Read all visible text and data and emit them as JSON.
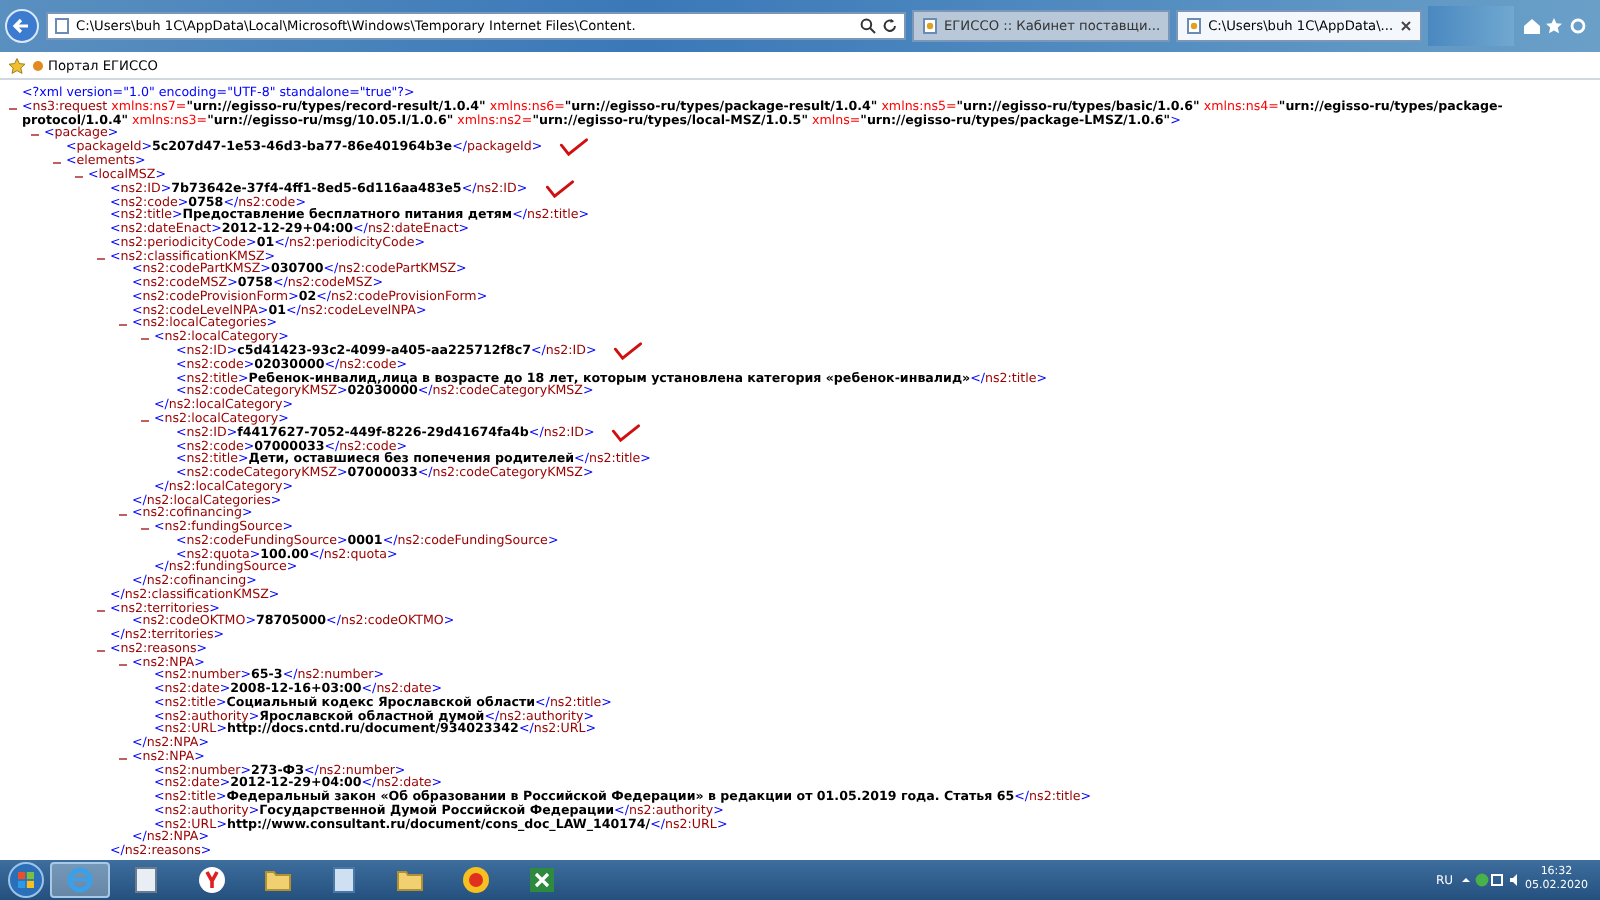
{
  "browser": {
    "address": "C:\\Users\\buh 1C\\AppData\\Local\\Microsoft\\Windows\\Temporary Internet Files\\Content.",
    "tabs": [
      {
        "title": "ЕГИССО :: Кабинет поставщи...",
        "selected": false
      },
      {
        "title": "C:\\Users\\buh 1C\\AppData\\...",
        "selected": true
      }
    ],
    "favorites": [
      {
        "label": "Портал ЕГИССО"
      }
    ]
  },
  "document": {
    "declaration": "<?xml version=\"1.0\" encoding=\"UTF-8\" standalone=\"true\"?>",
    "root": {
      "open": "<ns3:request",
      "attributes": [
        {
          "name": "xmlns:ns7=",
          "value": "\"urn://egisso-ru/types/record-result/1.0.4\""
        },
        {
          "name": "xmlns:ns6=",
          "value": "\"urn://egisso-ru/types/package-result/1.0.4\""
        },
        {
          "name": "xmlns:ns5=",
          "value": "\"urn://egisso-ru/types/basic/1.0.6\""
        },
        {
          "name": "xmlns:ns4=",
          "value": "\"urn://egisso-ru/types/package-protocol/1.0.4\""
        },
        {
          "name": "xmlns:ns3=",
          "value": "\"urn://egisso-ru/msg/10.05.I/1.0.6\""
        },
        {
          "name": "xmlns:ns2=",
          "value": "\"urn://egisso-ru/types/local-MSZ/1.0.5\""
        },
        {
          "name": "xmlns=",
          "value": "\"urn://egisso-ru/types/package-LMSZ/1.0.6\""
        }
      ],
      "open_end": ">",
      "expanded": true,
      "children": [
        {
          "open": "<package>",
          "expanded": true,
          "children": [
            {
              "open": "<packageId>",
              "value": "5c207d47-1e53-46d3-ba77-86e401964b3e",
              "close": "</packageId>",
              "annotated": true
            },
            {
              "open": "<elements>",
              "expanded": true,
              "children": [
                {
                  "open": "<localMSZ>",
                  "expanded": true,
                  "children": [
                    {
                      "open": "<ns2:ID>",
                      "value": "7b73642e-37f4-4ff1-8ed5-6d116aa483e5",
                      "close": "</ns2:ID>",
                      "annotated": true
                    },
                    {
                      "open": "<ns2:code>",
                      "value": "0758",
                      "close": "</ns2:code>",
                      "annotated": false
                    },
                    {
                      "open": "<ns2:title>",
                      "value": "Предоставление бесплатного питания детям",
                      "close": "</ns2:title>",
                      "annotated": false
                    },
                    {
                      "open": "<ns2:dateEnact>",
                      "value": "2012-12-29+04:00",
                      "close": "</ns2:dateEnact>",
                      "annotated": false
                    },
                    {
                      "open": "<ns2:periodicityCode>",
                      "value": "01",
                      "close": "</ns2:periodicityCode>",
                      "annotated": false
                    },
                    {
                      "open": "<ns2:classificationKMSZ>",
                      "expanded": true,
                      "close": "</ns2:classificationKMSZ>",
                      "children": [
                        {
                          "open": "<ns2:codePartKMSZ>",
                          "value": "030700",
                          "close": "</ns2:codePartKMSZ>",
                          "annotated": false
                        },
                        {
                          "open": "<ns2:codeMSZ>",
                          "value": "0758",
                          "close": "</ns2:codeMSZ>",
                          "annotated": false
                        },
                        {
                          "open": "<ns2:codeProvisionForm>",
                          "value": "02",
                          "close": "</ns2:codeProvisionForm>",
                          "annotated": false
                        },
                        {
                          "open": "<ns2:codeLevelNPA>",
                          "value": "01",
                          "close": "</ns2:codeLevelNPA>",
                          "annotated": false
                        },
                        {
                          "open": "<ns2:localCategories>",
                          "expanded": true,
                          "close": "</ns2:localCategories>",
                          "children": [
                            {
                              "open": "<ns2:localCategory>",
                              "expanded": true,
                              "close": "</ns2:localCategory>",
                              "children": [
                                {
                                  "open": "<ns2:ID>",
                                  "value": "c5d41423-93c2-4099-a405-aa225712f8c7",
                                  "close": "</ns2:ID>",
                                  "annotated": true
                                },
                                {
                                  "open": "<ns2:code>",
                                  "value": "02030000",
                                  "close": "</ns2:code>",
                                  "annotated": false
                                },
                                {
                                  "open": "<ns2:title>",
                                  "value": "Ребенок-инвалид,лица в возрасте до 18 лет, которым установлена категория «ребенок-инвалид»",
                                  "close": "</ns2:title>",
                                  "annotated": false
                                },
                                {
                                  "open": "<ns2:codeCategoryKMSZ>",
                                  "value": "02030000",
                                  "close": "</ns2:codeCategoryKMSZ>",
                                  "annotated": false
                                }
                              ]
                            },
                            {
                              "open": "<ns2:localCategory>",
                              "expanded": true,
                              "close": "</ns2:localCategory>",
                              "children": [
                                {
                                  "open": "<ns2:ID>",
                                  "value": "f4417627-7052-449f-8226-29d41674fa4b",
                                  "close": "</ns2:ID>",
                                  "annotated": true
                                },
                                {
                                  "open": "<ns2:code>",
                                  "value": "07000033",
                                  "close": "</ns2:code>",
                                  "annotated": false
                                },
                                {
                                  "open": "<ns2:title>",
                                  "value": "Дети, оставшиеся без попечения родителей",
                                  "close": "</ns2:title>",
                                  "annotated": false
                                },
                                {
                                  "open": "<ns2:codeCategoryKMSZ>",
                                  "value": "07000033",
                                  "close": "</ns2:codeCategoryKMSZ>",
                                  "annotated": false
                                }
                              ]
                            }
                          ]
                        },
                        {
                          "open": "<ns2:cofinancing>",
                          "expanded": true,
                          "close": "</ns2:cofinancing>",
                          "children": [
                            {
                              "open": "<ns2:fundingSource>",
                              "expanded": true,
                              "close": "</ns2:fundingSource>",
                              "children": [
                                {
                                  "open": "<ns2:codeFundingSource>",
                                  "value": "0001",
                                  "close": "</ns2:codeFundingSource>",
                                  "annotated": false
                                },
                                {
                                  "open": "<ns2:quota>",
                                  "value": "100.00",
                                  "close": "</ns2:quota>",
                                  "annotated": false
                                }
                              ]
                            }
                          ]
                        }
                      ]
                    },
                    {
                      "open": "<ns2:territories>",
                      "expanded": true,
                      "close": "</ns2:territories>",
                      "children": [
                        {
                          "open": "<ns2:codeOKTMO>",
                          "value": "78705000",
                          "close": "</ns2:codeOKTMO>",
                          "annotated": false
                        }
                      ]
                    },
                    {
                      "open": "<ns2:reasons>",
                      "expanded": true,
                      "close": "</ns2:reasons>",
                      "children": [
                        {
                          "open": "<ns2:NPA>",
                          "expanded": true,
                          "close": "</ns2:NPA>",
                          "children": [
                            {
                              "open": "<ns2:number>",
                              "value": "65-3",
                              "close": "</ns2:number>",
                              "annotated": false
                            },
                            {
                              "open": "<ns2:date>",
                              "value": "2008-12-16+03:00",
                              "close": "</ns2:date>",
                              "annotated": false
                            },
                            {
                              "open": "<ns2:title>",
                              "value": "Социальный кодекс Ярославской области",
                              "close": "</ns2:title>",
                              "annotated": false
                            },
                            {
                              "open": "<ns2:authority>",
                              "value": "Ярославской областной думой",
                              "close": "</ns2:authority>",
                              "annotated": false
                            },
                            {
                              "open": "<ns2:URL>",
                              "value": "http://docs.cntd.ru/document/934023342",
                              "close": "</ns2:URL>",
                              "annotated": false
                            }
                          ]
                        },
                        {
                          "open": "<ns2:NPA>",
                          "expanded": true,
                          "close": "</ns2:NPA>",
                          "children": [
                            {
                              "open": "<ns2:number>",
                              "value": "273-ФЗ",
                              "close": "</ns2:number>",
                              "annotated": false
                            },
                            {
                              "open": "<ns2:date>",
                              "value": "2012-12-29+04:00",
                              "close": "</ns2:date>",
                              "annotated": false
                            },
                            {
                              "open": "<ns2:title>",
                              "value": "Федеральный закон «Об образовании в Российской Федерации» в редакции от 01.05.2019 года. Статья 65",
                              "close": "</ns2:title>",
                              "annotated": false
                            },
                            {
                              "open": "<ns2:authority>",
                              "value": "Государственной Думой Российской Федерации",
                              "close": "</ns2:authority>",
                              "annotated": false
                            },
                            {
                              "open": "<ns2:URL>",
                              "value": "http://www.consultant.ru/document/cons_doc_LAW_140174/",
                              "close": "</ns2:URL>",
                              "annotated": false
                            }
                          ]
                        }
                      ]
                    }
                  ]
                }
              ]
            }
          ]
        }
      ]
    }
  },
  "taskbar": {
    "apps": [
      {
        "kind": "ie",
        "active": true
      },
      {
        "kind": "file",
        "active": false
      },
      {
        "kind": "yandex",
        "active": false
      },
      {
        "kind": "folder",
        "active": false
      },
      {
        "kind": "document",
        "active": false
      },
      {
        "kind": "folder",
        "active": false
      },
      {
        "kind": "onec",
        "active": false
      },
      {
        "kind": "excel",
        "active": false
      }
    ],
    "language": "RU",
    "time": "16:32",
    "date": "05.02.2020"
  }
}
